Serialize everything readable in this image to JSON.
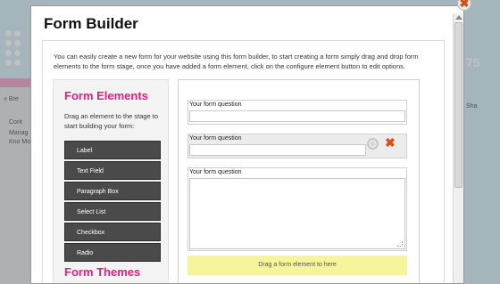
{
  "background": {
    "left_texts": [
      "« Bre",
      "Cont",
      "Manag",
      "Kno Mo"
    ],
    "right_badge": "75",
    "right_text": "Sha"
  },
  "modal": {
    "title": "Form Builder",
    "intro": "You can easily create a new form for your website using this form builder, to start creating a form simply drag and drop form elements to the form stage, once you have added a form element, click on the configure element button to edit options.",
    "close_symbol": "✖"
  },
  "left_panel": {
    "title": "Form Elements",
    "description": "Drag an element to the stage to start building your form:",
    "elements": [
      "Label",
      "Text Field",
      "Paragraph Box",
      "Select List",
      "Checkbox",
      "Radio"
    ],
    "themes_title": "Form Themes"
  },
  "stage": {
    "fields": [
      {
        "label": "Your form question"
      },
      {
        "label": "Your form question"
      },
      {
        "label": "Your form question"
      }
    ],
    "delete_symbol": "✖",
    "dropzone_text": "Drag a form element to here"
  },
  "colors": {
    "accent_pink": "#e0207c",
    "dropzone_yellow": "#f6f59c",
    "element_button": "#4a4a4a"
  }
}
